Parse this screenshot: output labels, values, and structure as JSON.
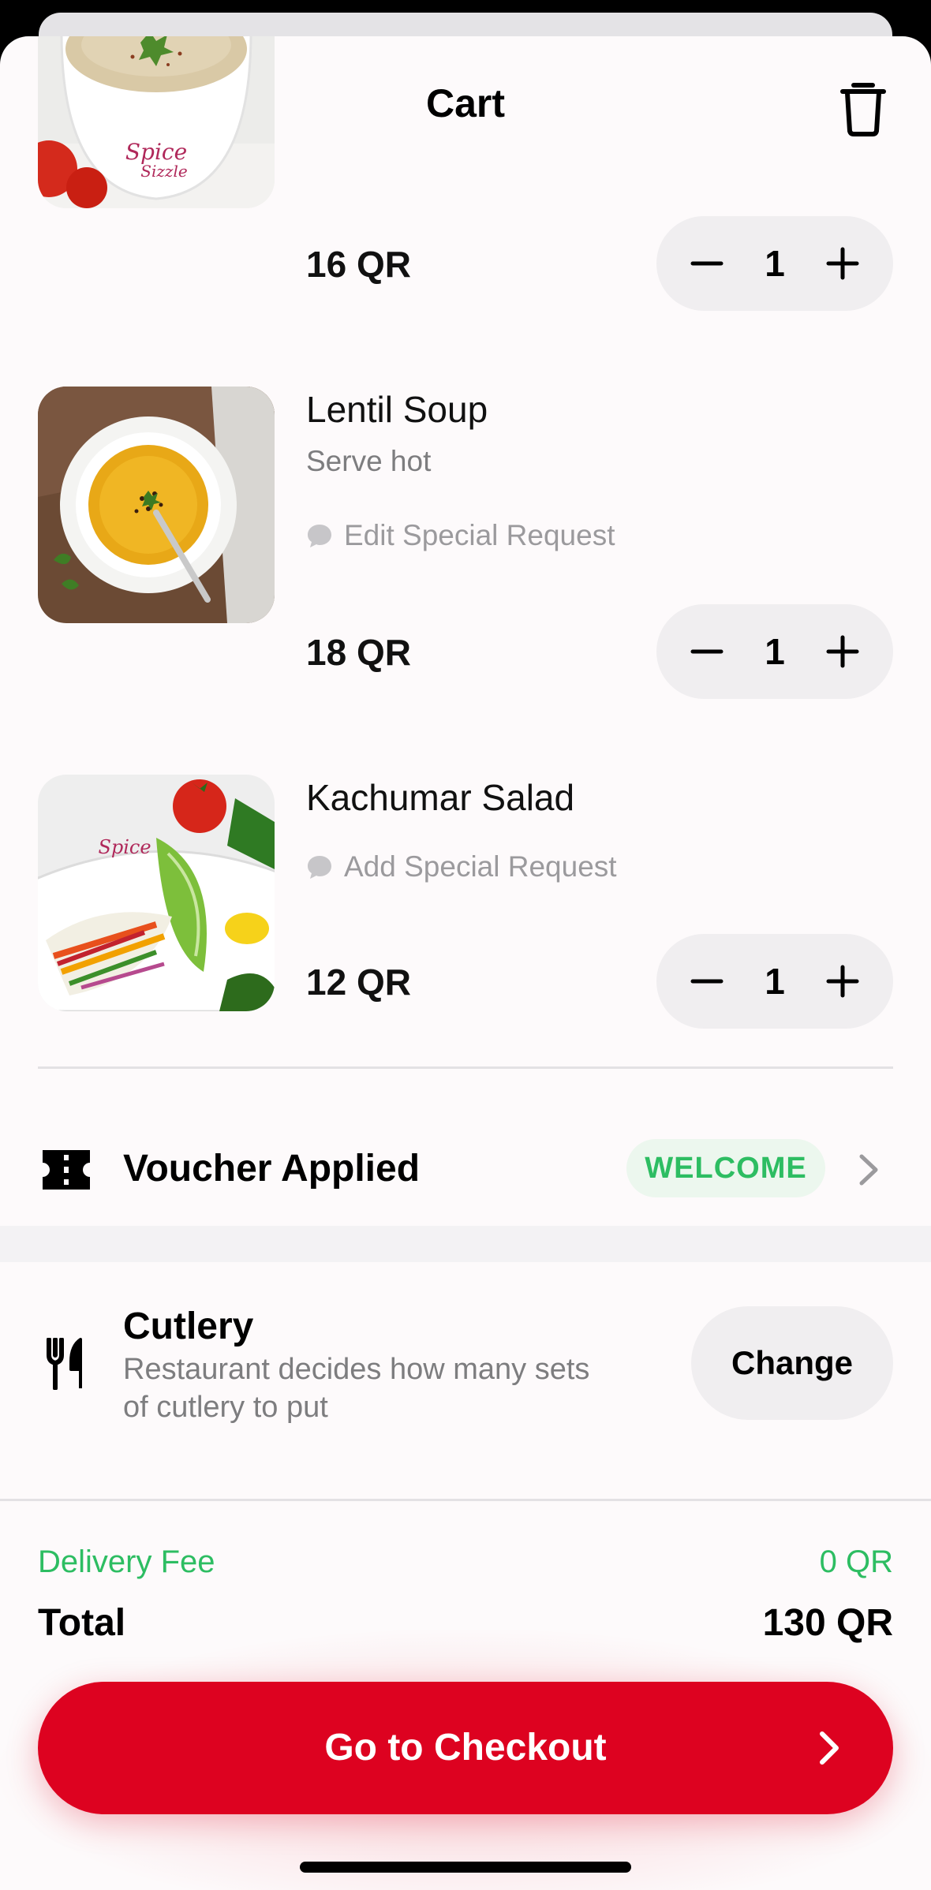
{
  "header": {
    "title": "Cart",
    "close_icon": "close-icon",
    "trash_icon": "trash-icon"
  },
  "items": [
    {
      "name": "",
      "price": "16 QR",
      "quantity": "1",
      "image": "cream-soup-bowl"
    },
    {
      "name": "Lentil Soup",
      "note": "Serve hot",
      "special_request": "Edit Special Request",
      "price": "18 QR",
      "quantity": "1",
      "image": "lentil-soup-bowl"
    },
    {
      "name": "Kachumar Salad",
      "special_request": "Add Special Request",
      "price": "12 QR",
      "quantity": "1",
      "image": "kachumar-salad-bowl"
    }
  ],
  "voucher": {
    "label": "Voucher Applied",
    "code": "WELCOME",
    "icon": "ticket-icon"
  },
  "cutlery": {
    "title": "Cutlery",
    "description": "Restaurant decides how many sets of cutlery to put",
    "button": "Change",
    "icon": "cutlery-icon"
  },
  "summary": {
    "delivery_fee_label": "Delivery Fee",
    "delivery_fee_value": "0 QR",
    "total_label": "Total",
    "total_value": "130 QR"
  },
  "checkout": {
    "label": "Go to Checkout"
  },
  "colors": {
    "brand_red": "#dd0220",
    "success_green": "#2dbd62",
    "muted_text": "#7d7d7f"
  }
}
